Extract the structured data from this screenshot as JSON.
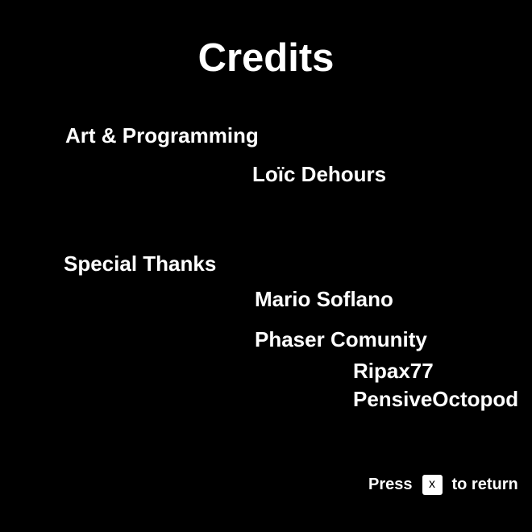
{
  "screen": {
    "title": "Credits"
  },
  "sections": [
    {
      "heading": "Art & Programming",
      "names": [
        "Loïc Dehours"
      ]
    },
    {
      "heading": "Special Thanks",
      "names": [
        "Mario Soflano",
        "Phaser Comunity"
      ],
      "community_members": [
        "Ripax77",
        "PensiveOctopod"
      ]
    }
  ],
  "footer": {
    "prefix": "Press",
    "key": "x",
    "suffix": "to return"
  },
  "colors": {
    "background": "#000000",
    "text": "#ffffff",
    "key_background": "#ffffff",
    "key_text": "#000000"
  }
}
